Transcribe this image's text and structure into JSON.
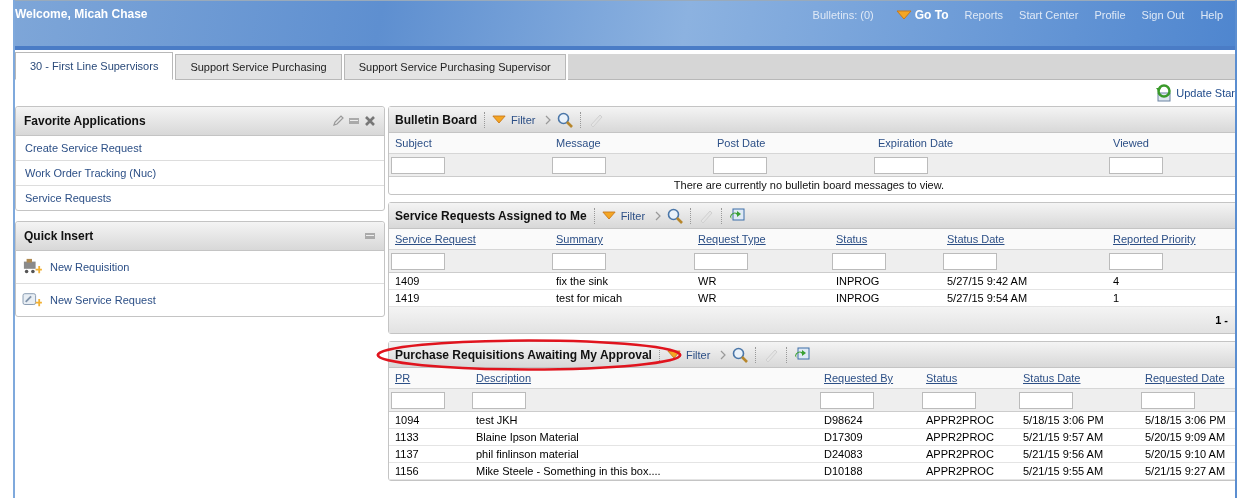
{
  "header": {
    "welcome": "Welcome, Micah Chase",
    "links": [
      {
        "kind": "link",
        "label": "Bulletins: (0)"
      },
      {
        "kind": "goto",
        "label": "Go To"
      },
      {
        "kind": "link",
        "label": "Reports"
      },
      {
        "kind": "link",
        "label": "Start Center"
      },
      {
        "kind": "link",
        "label": "Profile"
      },
      {
        "kind": "link",
        "label": "Sign Out"
      },
      {
        "kind": "link",
        "label": "Help"
      }
    ]
  },
  "tabs": [
    {
      "label": "30 - First Line Supervisors",
      "selected": true
    },
    {
      "label": "Support Service Purchasing",
      "selected": false
    },
    {
      "label": "Support Service Purchasing Supervisor",
      "selected": false
    }
  ],
  "update_link": "Update Star",
  "favorite_applications": {
    "title": "Favorite Applications",
    "items": [
      "Create Service Request",
      "Work Order Tracking (Nuc)",
      "Service Requests"
    ]
  },
  "quick_insert": {
    "title": "Quick Insert",
    "items": [
      {
        "kind": "requisition",
        "label": "New Requisition"
      },
      {
        "kind": "service",
        "label": "New Service Request"
      }
    ]
  },
  "panels": [
    {
      "title": "Bulletin Board",
      "filter_label": "Filter",
      "export": false,
      "circled": false,
      "columns_linked": false,
      "columns": [
        "Subject",
        "Message",
        "Post Date",
        "Expiration Date",
        "Viewed"
      ],
      "empty_message": "There are currently no bulletin board messages to view."
    },
    {
      "title": "Service Requests Assigned to Me",
      "filter_label": "Filter",
      "export": true,
      "circled": false,
      "columns_linked": true,
      "columns": [
        "Service Request",
        "Summary",
        "Request Type",
        "Status",
        "Status Date",
        "Reported Priority"
      ],
      "rows": [
        [
          "1409",
          "fix the sink",
          "WR",
          "INPROG",
          "5/27/15 9:42 AM",
          "4"
        ],
        [
          "1419",
          "test for micah",
          "WR",
          "INPROG",
          "5/27/15 9:54 AM",
          "1"
        ]
      ],
      "pager": "1 -"
    },
    {
      "title": "Purchase Requisitions Awaiting My Approval",
      "filter_label": "Filter",
      "export": true,
      "circled": true,
      "columns_linked": true,
      "columns": [
        "PR",
        "Description",
        "Requested By",
        "Status",
        "Status Date",
        "Requested Date"
      ],
      "rows": [
        [
          "1094",
          "test JKH",
          "D98624",
          "APPR2PROC",
          "5/18/15 3:06 PM",
          "5/18/15 3:06 PM"
        ],
        [
          "1133",
          "Blaine Ipson Material",
          "D17309",
          "APPR2PROC",
          "5/21/15 9:57 AM",
          "5/20/15 9:09 AM"
        ],
        [
          "1137",
          "phil finlinson material",
          "D24083",
          "APPR2PROC",
          "5/21/15 9:56 AM",
          "5/20/15 9:10 AM"
        ],
        [
          "1156",
          "Mike Steele - Something in this box....",
          "D10188",
          "APPR2PROC",
          "5/21/15 9:55 AM",
          "5/21/15 9:27 AM"
        ]
      ]
    }
  ]
}
